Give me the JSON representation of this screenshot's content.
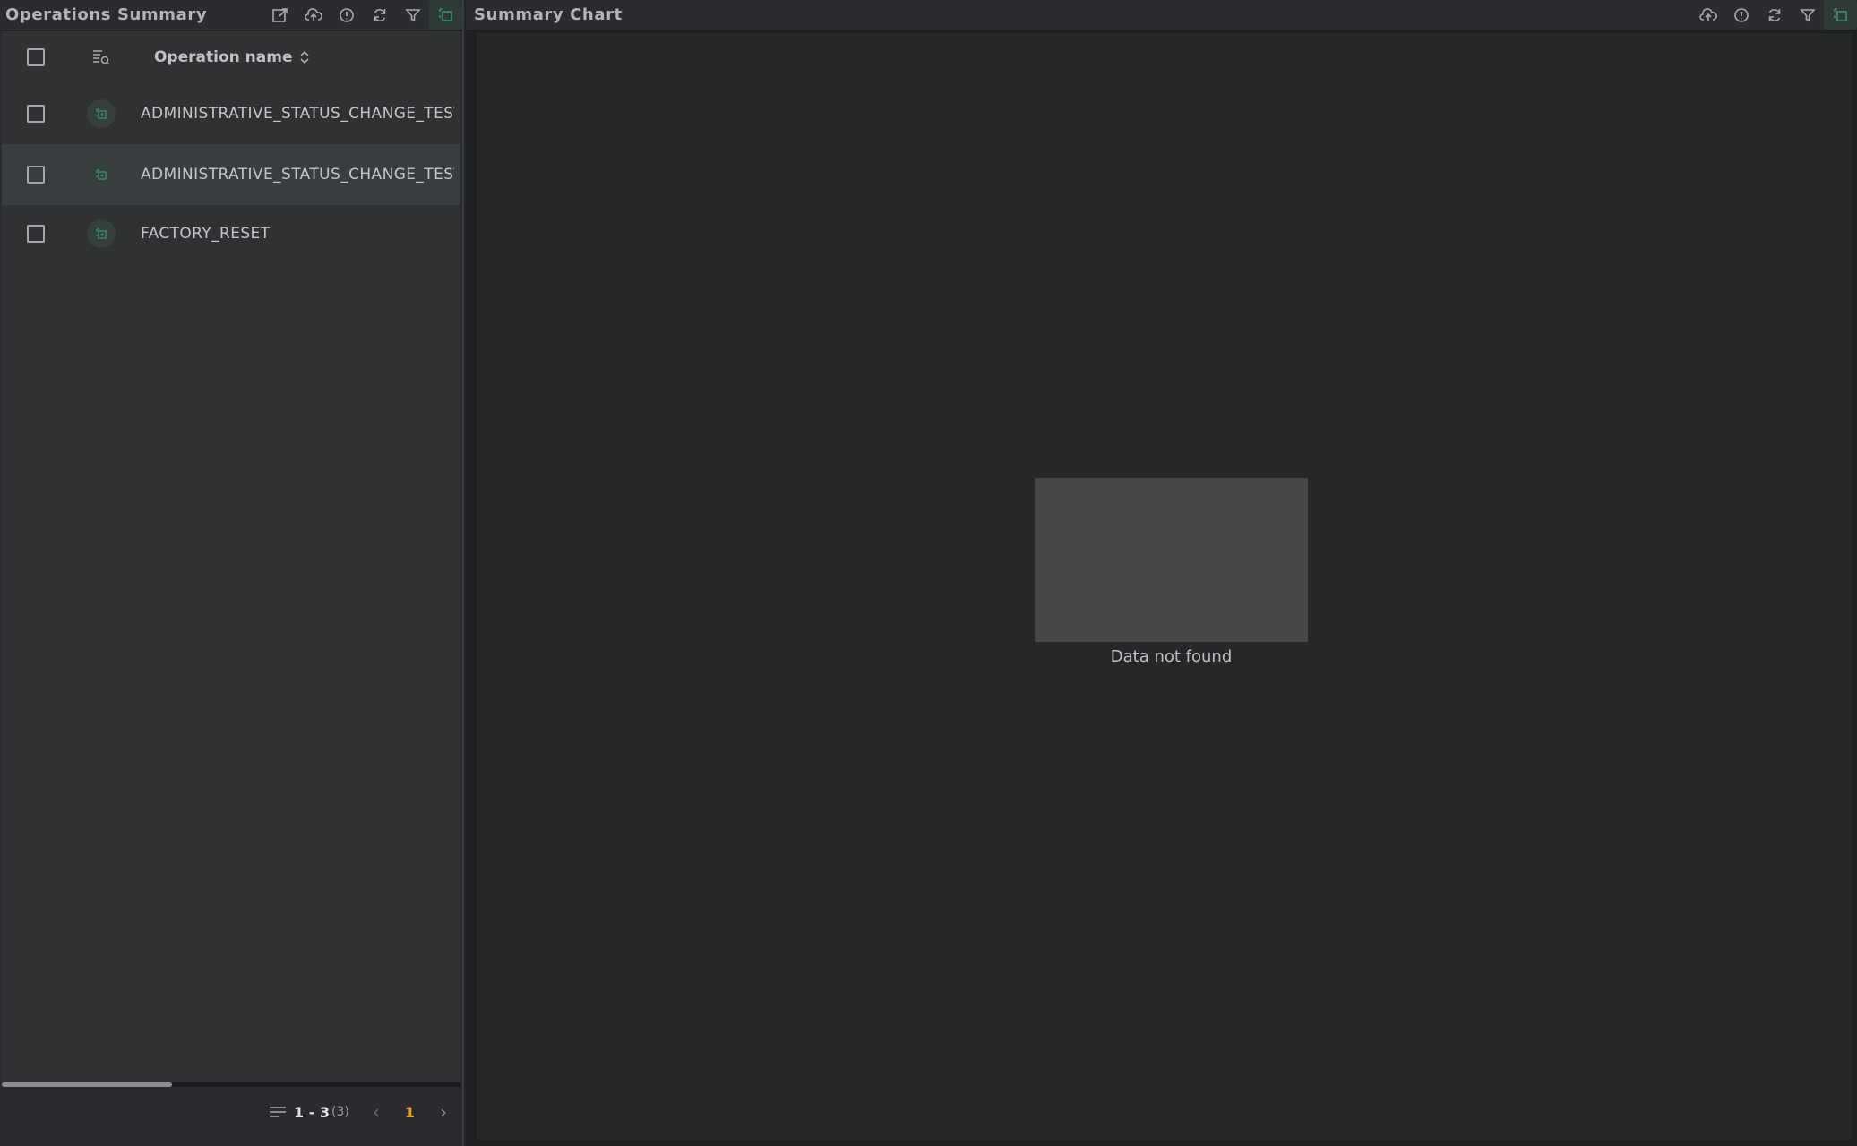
{
  "left_panel": {
    "title": "Operations Summary",
    "header_icons": [
      "export-icon",
      "upload-icon",
      "info-icon",
      "refresh-icon",
      "filter-icon",
      "expand-icon"
    ],
    "table": {
      "column_header": "Operation name",
      "rows": [
        {
          "label": "ADMINISTRATIVE_STATUS_CHANGE_TEST",
          "selected": false
        },
        {
          "label": "ADMINISTRATIVE_STATUS_CHANGE_TEST",
          "selected": true
        },
        {
          "label": "FACTORY_RESET",
          "selected": false
        }
      ]
    },
    "pagination": {
      "range": "1 - 3",
      "total": "(3)",
      "current_page": "1"
    }
  },
  "right_panel": {
    "title": "Summary Chart",
    "header_icons": [
      "upload-icon",
      "info-icon",
      "refresh-icon",
      "filter-icon",
      "expand-icon"
    ],
    "empty_state": "Data not found"
  },
  "colors": {
    "accent_green": "#3f8f73",
    "page_number": "#e8a51f",
    "panel_bg": "#303133",
    "selected_row": "#3a3d3f"
  }
}
